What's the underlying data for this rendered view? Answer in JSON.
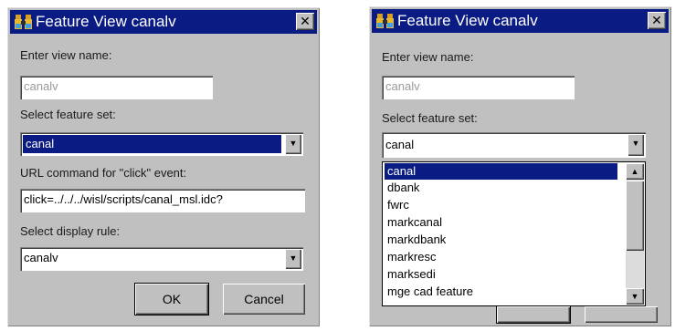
{
  "left_dialog": {
    "title": "Feature View canalv",
    "close_glyph": "✕",
    "view_name_label": "Enter view name:",
    "view_name_value": "canalv",
    "feature_set_label": "Select feature set:",
    "feature_set_value": "canal",
    "url_label": "URL command for \"click\" event:",
    "url_value": "click=../../../wisl/scripts/canal_msl.idc?",
    "display_rule_label": "Select display rule:",
    "display_rule_value": "canalv",
    "ok_label": "OK",
    "cancel_label": "Cancel",
    "dropdown_glyph": "▼"
  },
  "right_dialog": {
    "title": "Feature View canalv",
    "close_glyph": "✕",
    "view_name_label": "Enter view name:",
    "view_name_value": "canalv",
    "feature_set_label": "Select feature set:",
    "feature_set_value": "canal",
    "dropdown_glyph": "▼",
    "scroll_up_glyph": "▲",
    "scroll_down_glyph": "▼",
    "list_items": [
      "canal",
      "dbank",
      "fwrc",
      "markcanal",
      "markdbank",
      "markresc",
      "marksedi",
      "mge cad feature"
    ]
  },
  "colors": {
    "titlebar": "#0a1c84",
    "dialog_face": "#c0c0c0",
    "selection": "#0a1c84"
  },
  "icons": [
    "binoculars-icon",
    "close-icon",
    "chevron-down-icon",
    "scroll-up-icon",
    "scroll-down-icon"
  ]
}
